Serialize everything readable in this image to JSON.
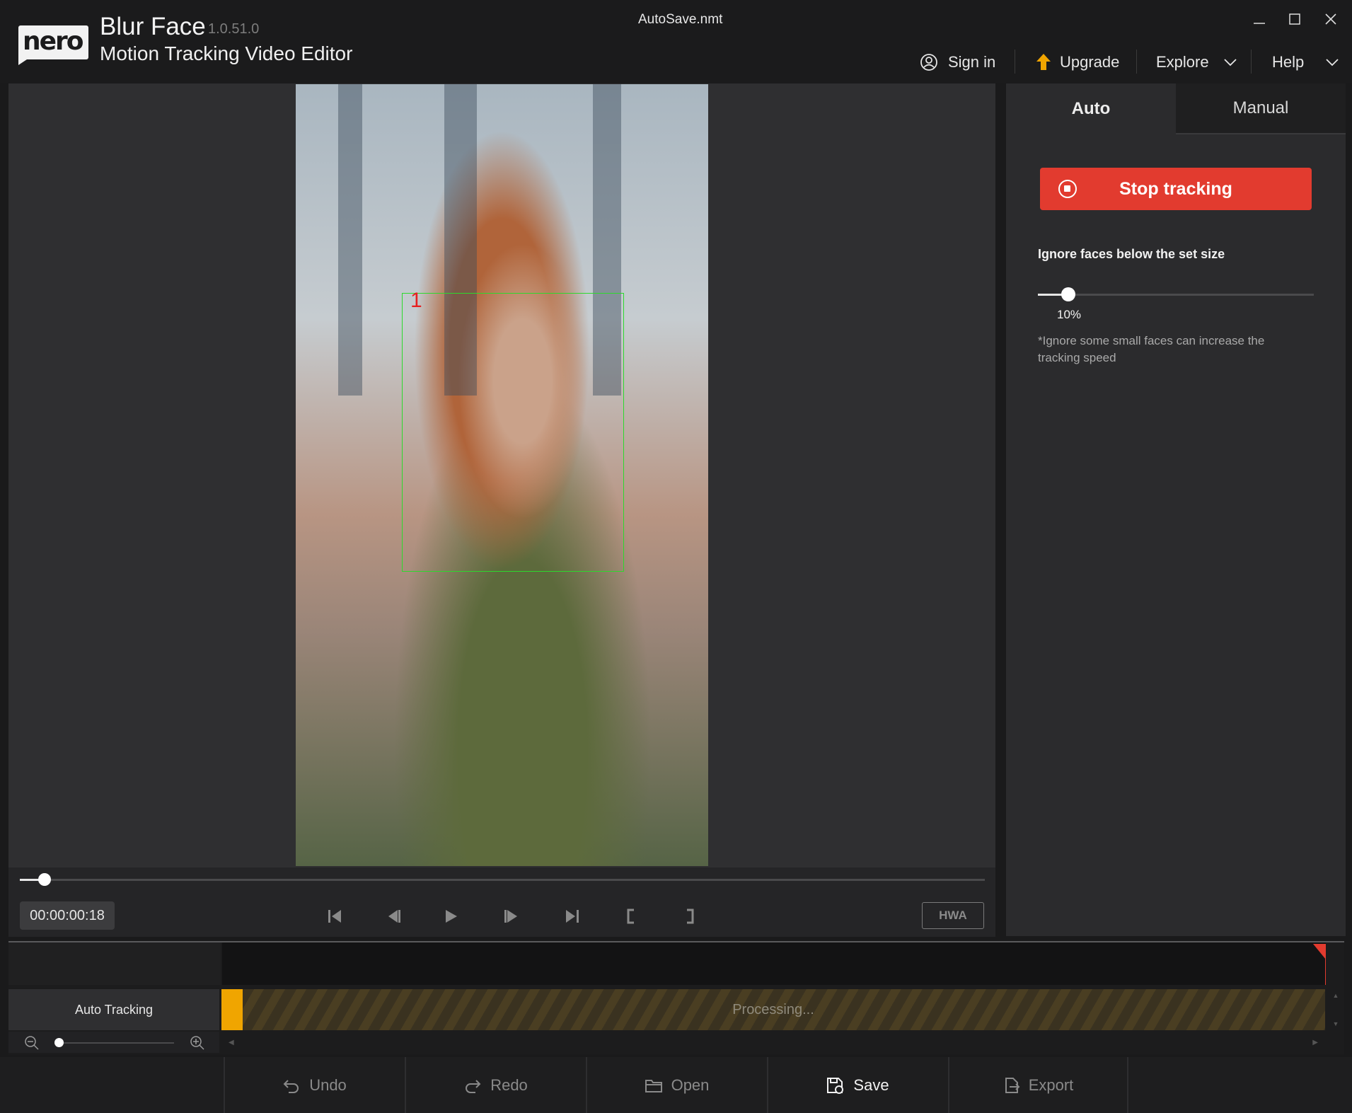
{
  "header": {
    "logo_text": "nero",
    "app_title": "Blur Face",
    "version": "1.0.51.0",
    "subtitle": "Motion Tracking Video Editor",
    "file_name": "AutoSave.nmt",
    "nav": {
      "sign_in": "Sign in",
      "upgrade": "Upgrade",
      "explore": "Explore",
      "help": "Help"
    }
  },
  "preview": {
    "face_box_number": "1",
    "timecode": "00:00:00:18",
    "hwa_label": "HWA",
    "scrub_progress": 0.02
  },
  "panel": {
    "tabs": [
      "Auto",
      "Manual"
    ],
    "active_tab": "Auto",
    "stop_tracking_label": "Stop tracking",
    "setting_label": "Ignore faces below the set size",
    "slider_value": "10%",
    "hint": "*Ignore some small faces can increase the tracking speed"
  },
  "timeline": {
    "track_label": "Auto Tracking",
    "processing_label": "Processing..."
  },
  "toolbar": {
    "undo": "Undo",
    "redo": "Redo",
    "open": "Open",
    "save": "Save",
    "export": "Export"
  },
  "colors": {
    "accent_red": "#e23b2f",
    "face_box_green": "#2cd92c",
    "track_orange": "#f0a500"
  }
}
